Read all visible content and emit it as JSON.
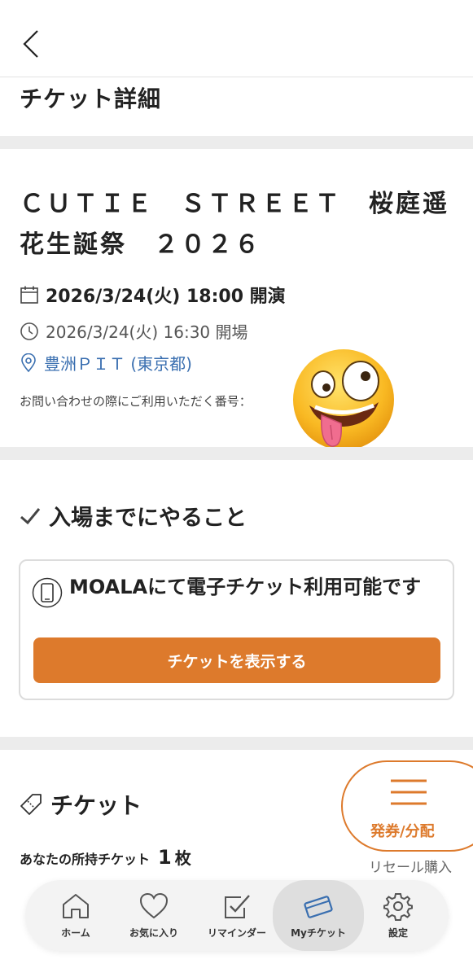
{
  "header": {
    "title": "チケット詳細"
  },
  "event": {
    "title": "ＣＵＴＩＥ　ＳＴＲＥＥＴ　桜庭遥花生誕祭　２０２６",
    "start": "2026/3/24(火) 18:00 開演",
    "open": "2026/3/24(火) 16:30 開場",
    "venue": "豊洲ＰＩＴ (東京都)",
    "inquiry_label": "お問い合わせの際にご利用いただく番号："
  },
  "todo": {
    "title": "入場までにやること",
    "eticket_text": "MOALAにて電子チケット利用可能です",
    "show_button": "チケットを表示する"
  },
  "tickets": {
    "title": "チケット",
    "owned_label": "あなたの所持チケット",
    "owned_count": "1",
    "owned_unit": "枚"
  },
  "fab": {
    "label": "発券/分配"
  },
  "resale": {
    "label": "リセール購入"
  },
  "nav": {
    "items": [
      {
        "label": "ホーム",
        "icon": "home-icon"
      },
      {
        "label": "お気に入り",
        "icon": "heart-icon"
      },
      {
        "label": "リマインダー",
        "icon": "checkbox-icon"
      },
      {
        "label": "Myチケット",
        "icon": "ticket-icon"
      },
      {
        "label": "設定",
        "icon": "gear-icon"
      }
    ],
    "active": "Myチケット"
  },
  "colors": {
    "accent": "#dd7a2c",
    "link": "#3a6fb0",
    "separator": "#ececec",
    "nav_active": "#dedede"
  }
}
